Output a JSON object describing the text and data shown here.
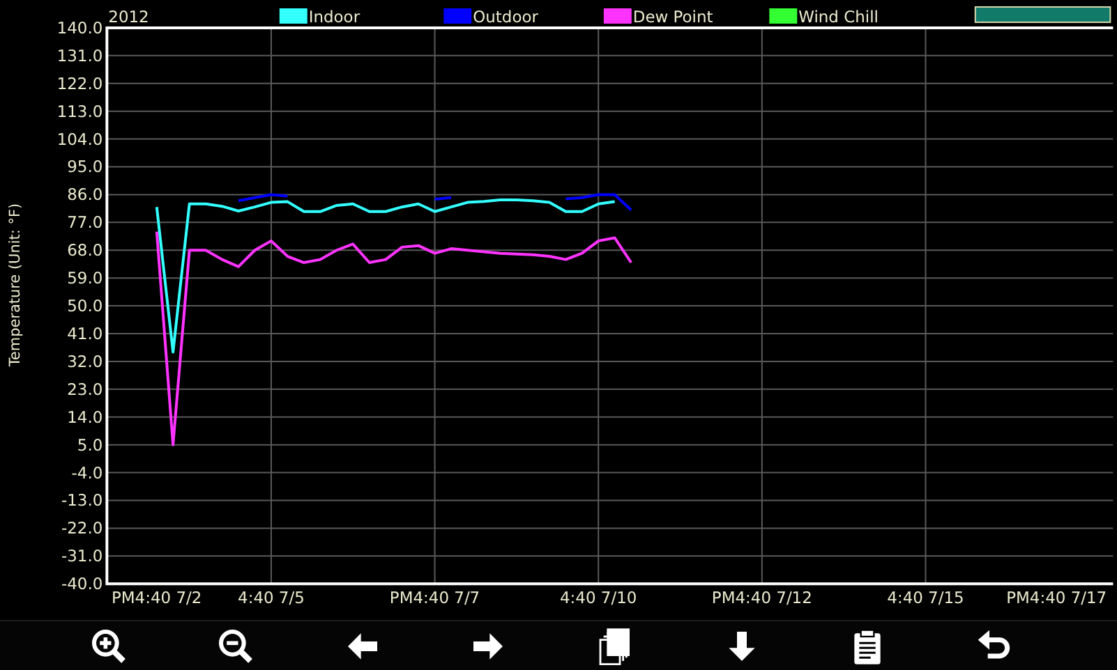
{
  "chart_data": {
    "type": "line",
    "title": "2012",
    "ylabel": "Temperature (Unit: °F)",
    "grid": true,
    "legend": true,
    "categories": [
      "PM4:40 7/2",
      null,
      null,
      null,
      null,
      null,
      null,
      "4:40 7/5",
      null,
      null,
      null,
      null,
      null,
      null,
      null,
      null,
      null,
      "PM4:40 7/7",
      null,
      null,
      null,
      null,
      null,
      null,
      null,
      null,
      null,
      "4:40 7/10",
      null,
      null,
      null,
      null,
      null,
      null,
      null,
      null,
      null,
      "PM4:40 7/12",
      null,
      null,
      null,
      null,
      null,
      null,
      null,
      null,
      null,
      "4:40 7/15",
      null,
      null,
      null,
      null,
      null,
      null,
      null,
      "PM4:40 7/17",
      null,
      null,
      null
    ],
    "series": [
      {
        "name": "Indoor",
        "color": "#33ffff",
        "values": [
          82,
          35,
          83,
          83,
          82.2,
          80.7,
          82,
          83.5,
          83.7,
          80.5,
          80.5,
          82.5,
          83,
          80.5,
          80.5,
          82,
          83,
          80.5,
          82,
          83.5,
          83.8,
          84.3,
          84.3,
          84,
          83.5,
          80.5,
          80.5,
          83,
          83.7,
          null,
          null,
          null,
          null,
          null,
          null,
          null,
          null,
          null,
          null,
          null,
          null,
          null,
          null,
          null,
          null,
          null,
          null,
          null,
          null,
          null,
          null,
          null,
          null,
          null,
          null,
          null,
          null,
          null,
          null
        ]
      },
      {
        "name": "Outdoor",
        "color": "#0000ff",
        "values": [
          null,
          null,
          null,
          null,
          null,
          84,
          85,
          86,
          85.5,
          null,
          null,
          null,
          null,
          null,
          null,
          null,
          null,
          84.5,
          85,
          null,
          null,
          null,
          null,
          null,
          null,
          84.6,
          85,
          86,
          86,
          81,
          null,
          null,
          null,
          null,
          null,
          null,
          null,
          null,
          null,
          null,
          null,
          null,
          null,
          null,
          null,
          null,
          null,
          null,
          null,
          null,
          null,
          null,
          null,
          null,
          null,
          null,
          null,
          null,
          null
        ]
      },
      {
        "name": "Dew Point",
        "color": "#ff33ff",
        "values": [
          74,
          5,
          68,
          68,
          65,
          62.7,
          68,
          71,
          66,
          64,
          65,
          68,
          70,
          64,
          65,
          69,
          69.5,
          67,
          68.5,
          68,
          67.5,
          67,
          66.8,
          66.5,
          66,
          65,
          67,
          71,
          72,
          64,
          null,
          null,
          null,
          null,
          null,
          null,
          null,
          null,
          null,
          null,
          null,
          null,
          null,
          null,
          null,
          null,
          null,
          null,
          null,
          null,
          null,
          null,
          null,
          null,
          null,
          null,
          null,
          null,
          null
        ]
      },
      {
        "name": "Wind Chill",
        "color": "#33ff33",
        "values": [
          null,
          null,
          null,
          null,
          null,
          null,
          null,
          null,
          null,
          null,
          null,
          null,
          null,
          null,
          null,
          null,
          null,
          null,
          null,
          null,
          null,
          null,
          null,
          null,
          null,
          null,
          null,
          null,
          null,
          null,
          null,
          null,
          null,
          null,
          null,
          null,
          null,
          null,
          null,
          null,
          null,
          null,
          null,
          null,
          null,
          null,
          null,
          null,
          null,
          null,
          null,
          null,
          null,
          null,
          null,
          null,
          null,
          null,
          null
        ]
      }
    ],
    "ylim": [
      -40,
      140
    ],
    "yticks": [
      {
        "value": 140,
        "label": "140.0"
      },
      {
        "value": 131,
        "label": "131.0"
      },
      {
        "value": 122,
        "label": "122.0"
      },
      {
        "value": 113,
        "label": "113.0"
      },
      {
        "value": 104,
        "label": "104.0"
      },
      {
        "value": 95,
        "label": "95.0"
      },
      {
        "value": 86,
        "label": "86.0"
      },
      {
        "value": 77,
        "label": "77.0"
      },
      {
        "value": 68,
        "label": "68.0"
      },
      {
        "value": 59,
        "label": "59.0"
      },
      {
        "value": 50,
        "label": "50.0"
      },
      {
        "value": 41,
        "label": "41.0"
      },
      {
        "value": 32,
        "label": "32.0"
      },
      {
        "value": 23,
        "label": "23.0"
      },
      {
        "value": 14,
        "label": "14.0"
      },
      {
        "value": 5,
        "label": "5.0"
      },
      {
        "value": -4,
        "label": "-4.0"
      },
      {
        "value": -13,
        "label": "-13.0"
      },
      {
        "value": -22,
        "label": "-22.0"
      },
      {
        "value": -31,
        "label": "-31.0"
      },
      {
        "value": -40,
        "label": "-40.0"
      }
    ]
  },
  "toolbar": [
    {
      "kind": "zoom_in"
    },
    {
      "kind": "zoom_out"
    },
    {
      "kind": "left"
    },
    {
      "kind": "right"
    },
    {
      "kind": "copy"
    },
    {
      "kind": "down"
    },
    {
      "kind": "clipboard"
    },
    {
      "kind": "undo"
    }
  ]
}
